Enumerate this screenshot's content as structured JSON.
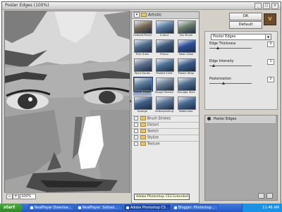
{
  "window": {
    "title": "Poster Edges (100%)",
    "controls": [
      "_",
      "□",
      "×"
    ]
  },
  "preview": {
    "zoom_value": "100%",
    "zoom_out": "−",
    "zoom_in": "+"
  },
  "gallery": {
    "expanded_category": "Artistic",
    "filters": [
      {
        "label": "Colored Pencil",
        "color": "#7a6b55"
      },
      {
        "label": "Cutout",
        "color": "#5a7aa0"
      },
      {
        "label": "Dry Brush",
        "color": "#6b7d6a"
      },
      {
        "label": "Film Grain",
        "color": "#4d6a8c"
      },
      {
        "label": "Fresco",
        "color": "#3e5a7a"
      },
      {
        "label": "Neon Glow",
        "color": "#2d4f9a"
      },
      {
        "label": "Paint Daubs",
        "color": "#5c6e8a"
      },
      {
        "label": "Palette Knife",
        "color": "#4a6f94"
      },
      {
        "label": "Plastic Wrap",
        "color": "#3c5c88"
      },
      {
        "label": "Poster Edges",
        "color": "#5b7b9c"
      },
      {
        "label": "Rough Pastels",
        "color": "#6a7f96"
      },
      {
        "label": "Smudge Stick",
        "color": "#4f6d8e"
      },
      {
        "label": "Sponge",
        "color": "#3f6088"
      },
      {
        "label": "Underpainting",
        "color": "#5a7496"
      },
      {
        "label": "Watercolor",
        "color": "#486a92"
      }
    ],
    "categories": [
      "Brush Strokes",
      "Distort",
      "Sketch",
      "Stylize",
      "Texture"
    ]
  },
  "panel": {
    "ok_label": "OK",
    "default_label": "Default",
    "filter_select": "Poster Edges",
    "params": [
      {
        "label": "Edge Thickness",
        "value": "2",
        "level": 0.2
      },
      {
        "label": "Edge Intensity",
        "value": "1",
        "level": 0.1
      },
      {
        "label": "Posterization",
        "value": "2",
        "level": 0.33
      }
    ],
    "layer_name": "Poster Edges"
  },
  "taskbar": {
    "start_label": "start",
    "tooltip": "Adobe Photoshop CS3 Extended",
    "items": [
      {
        "label": "RealPlayer Downloa..."
      },
      {
        "label": "RealPlayer: Sotbad..."
      },
      {
        "label": "Adobe Photoshop CS..."
      },
      {
        "label": "Blogger: Photoshop..."
      }
    ],
    "clock": "11:46 AM"
  },
  "colors": {
    "taskbar": "#2457c9",
    "start": "#3a9a30",
    "window_bg": "#d4d0c8"
  }
}
